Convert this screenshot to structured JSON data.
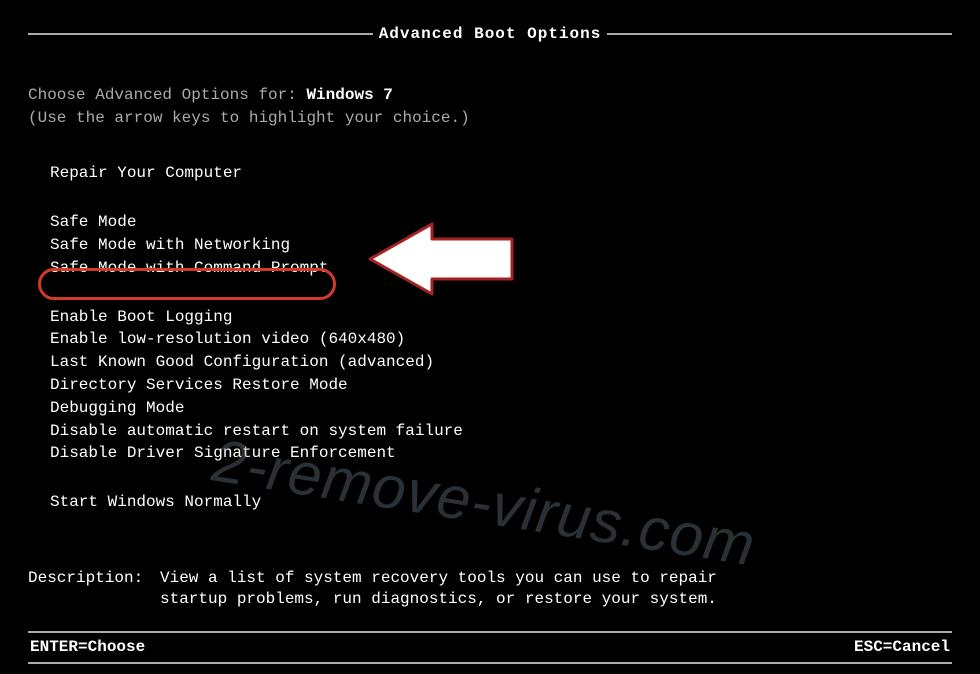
{
  "title": "Advanced Boot Options",
  "prompt": {
    "prefix": "Choose Advanced Options for: ",
    "os": "Windows 7",
    "hint": "(Use the arrow keys to highlight your choice.)"
  },
  "group1": {
    "repair": "Repair Your Computer"
  },
  "group2": {
    "safe_mode": "Safe Mode",
    "safe_mode_net": "Safe Mode with Networking",
    "safe_mode_cmd": "Safe Mode with Command Prompt"
  },
  "group3": {
    "boot_logging": "Enable Boot Logging",
    "low_res": "Enable low-resolution video (640x480)",
    "last_known": "Last Known Good Configuration (advanced)",
    "ds_restore": "Directory Services Restore Mode",
    "debugging": "Debugging Mode",
    "disable_restart": "Disable automatic restart on system failure",
    "disable_driver_sig": "Disable Driver Signature Enforcement"
  },
  "group4": {
    "start_normal": "Start Windows Normally"
  },
  "description": {
    "label": "Description:",
    "text": "View a list of system recovery tools you can use to repair startup problems, run diagnostics, or restore your system."
  },
  "footer": {
    "enter": "ENTER=Choose",
    "esc": "ESC=Cancel"
  },
  "watermark": "2-remove-virus.com"
}
